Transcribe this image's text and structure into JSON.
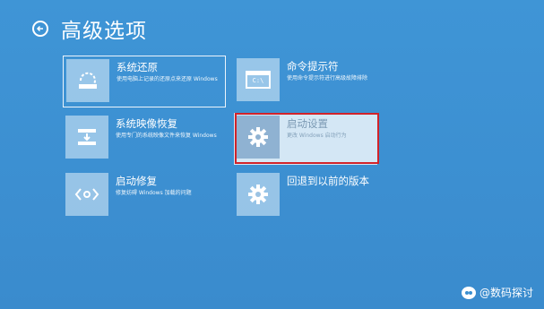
{
  "header": {
    "title": "高级选项",
    "back_icon": "back-arrow-icon"
  },
  "options": {
    "system_restore": {
      "name": "系统还原",
      "desc": "使用电脑上记录的还原点来还原 Windows",
      "icon": "restore-icon"
    },
    "image_recovery": {
      "name": "系统映像恢复",
      "desc": "使用专门的系统映像文件来恢复 Windows",
      "icon": "disk-image-icon"
    },
    "startup_repair": {
      "name": "启动修复",
      "desc": "修复妨碍 Windows 加载的问题",
      "icon": "code-icon"
    },
    "command_prompt": {
      "name": "命令提示符",
      "desc": "使用命令提示符进行高级故障排除",
      "icon": "cmd-icon",
      "icon_text": "C:\\"
    },
    "startup_settings": {
      "name": "启动设置",
      "desc": "更改 Windows 启动行为",
      "icon": "gear-icon"
    },
    "go_back": {
      "name": "回退到以前的版本",
      "icon": "gear-icon"
    }
  },
  "watermark": {
    "text": "@数码探讨"
  },
  "colors": {
    "background": "#3a8fd0",
    "highlight_border": "#d2232a"
  }
}
